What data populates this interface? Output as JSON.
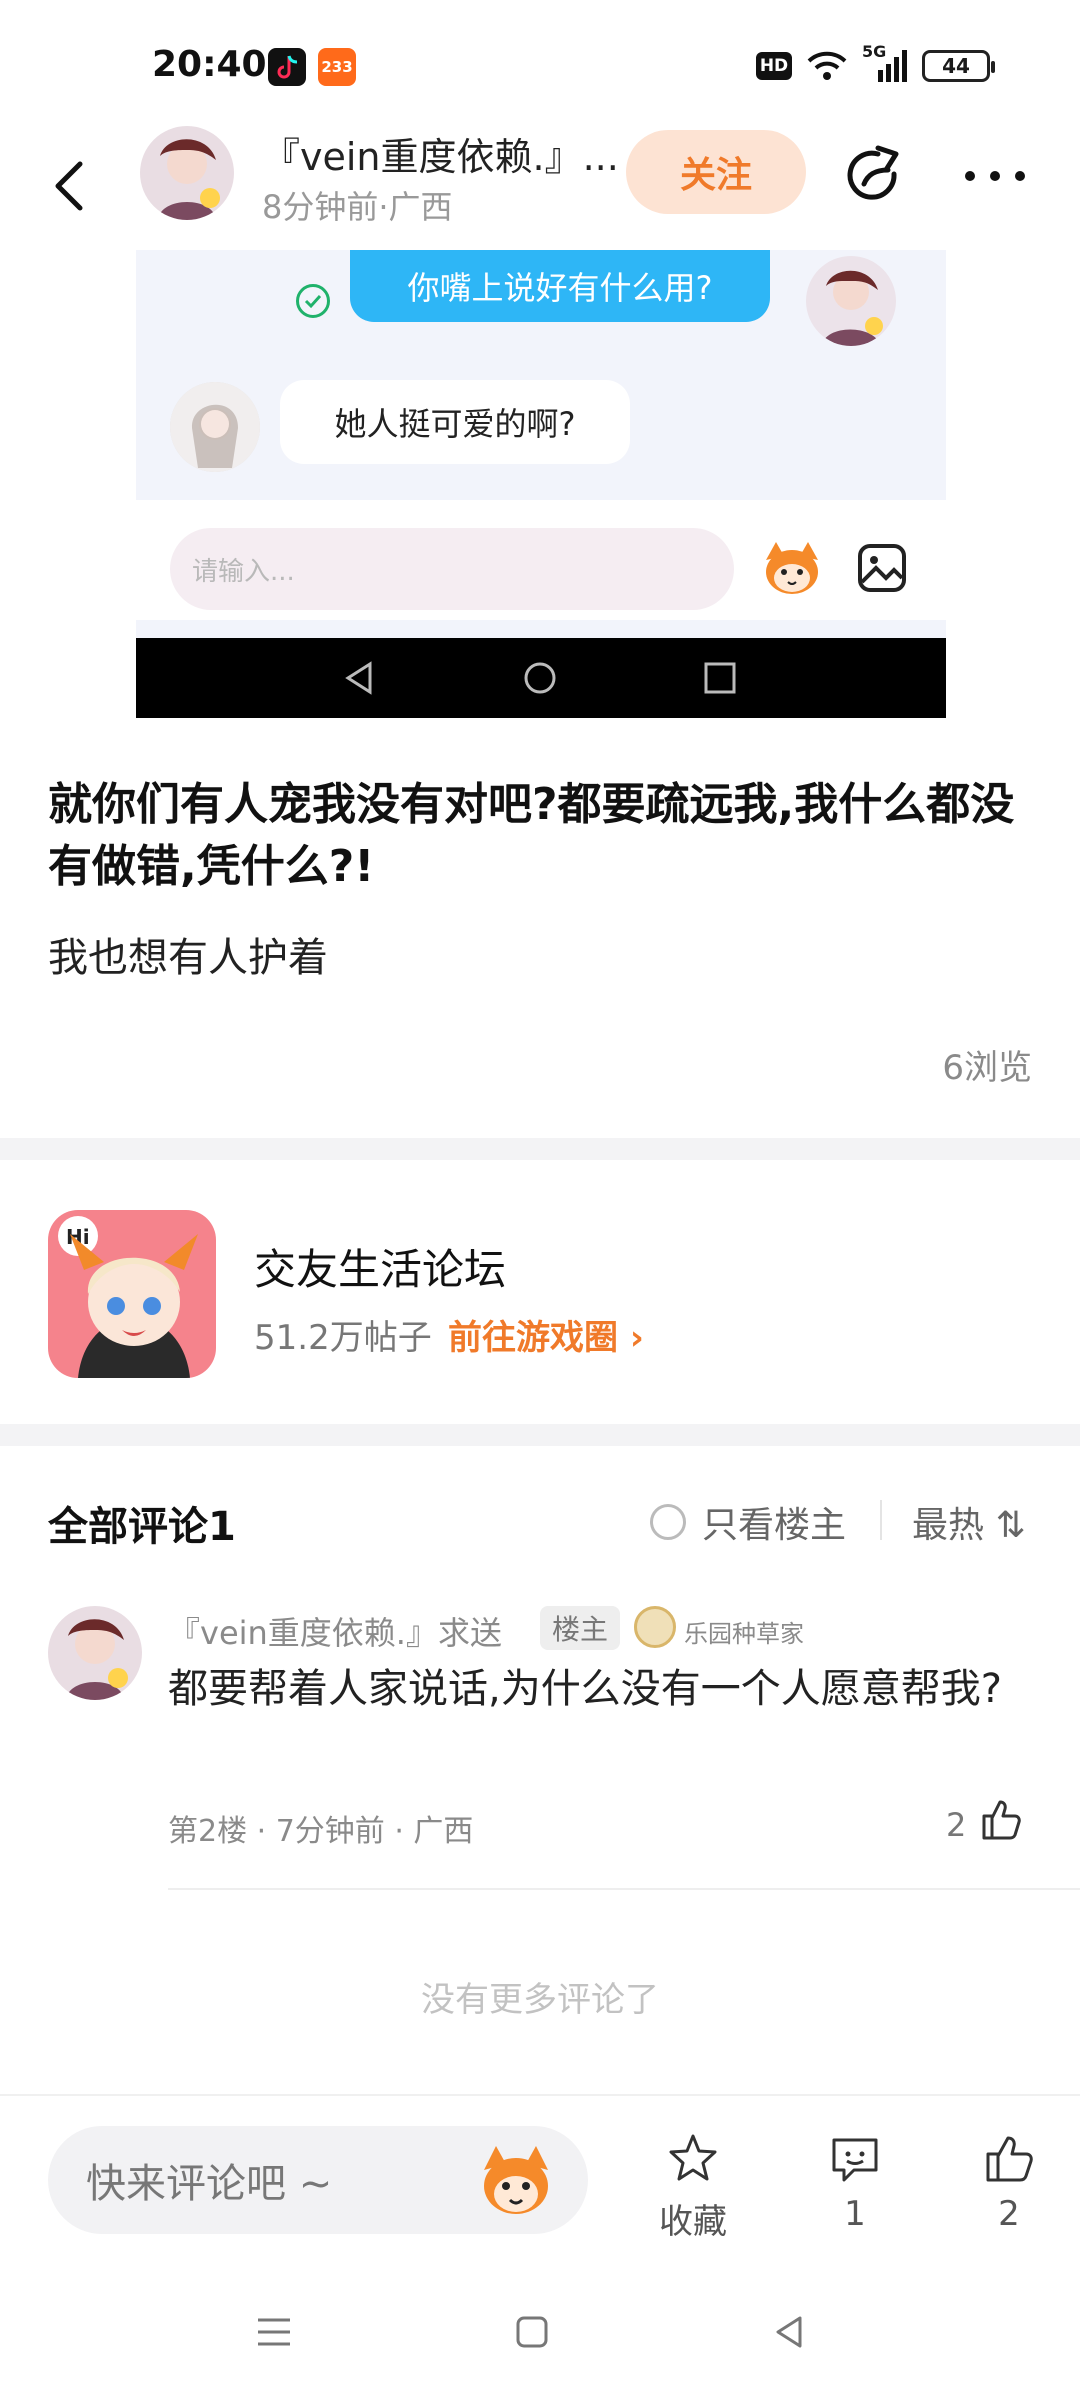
{
  "status_bar": {
    "time": "20:40",
    "hd": "HD",
    "network": "5G",
    "battery": "44"
  },
  "header": {
    "username": "『vein重度依赖.』...",
    "meta": "8分钟前·广西",
    "follow_label": "关注"
  },
  "embedded_screenshot": {
    "message_right": "你嘴上说好有什么用?",
    "message_left": "她人挺可爱的啊?",
    "input_placeholder": "请输入..."
  },
  "post": {
    "title": "就你们有人宠我没有对吧?都要疏远我,我什么都没有做错,凭什么?!",
    "body": "我也想有人护着",
    "views": "6浏览"
  },
  "forum": {
    "name": "交友生活论坛",
    "posts": "51.2万帖子",
    "link_label": "前往游戏圈 ›"
  },
  "comments": {
    "title": "全部评论1",
    "only_op_label": "只看楼主",
    "sort_label": "最热 ⇅",
    "items": [
      {
        "name": "『vein重度依赖.』求送",
        "badge": "楼主",
        "medal": "乐园种草家",
        "text": "都要帮着人家说话,为什么没有一个人愿意帮我?",
        "meta": "第2楼 · 7分钟前 · 广西",
        "likes": "2"
      }
    ],
    "no_more": "没有更多评论了"
  },
  "bottom_bar": {
    "comment_placeholder": "快来评论吧 ~",
    "favorite_label": "收藏",
    "comment_count": "1",
    "like_count": "2"
  },
  "colors": {
    "accent": "#f07a2a",
    "follow_bg": "#fde3d3",
    "chat_blue": "#2eb6f6"
  }
}
